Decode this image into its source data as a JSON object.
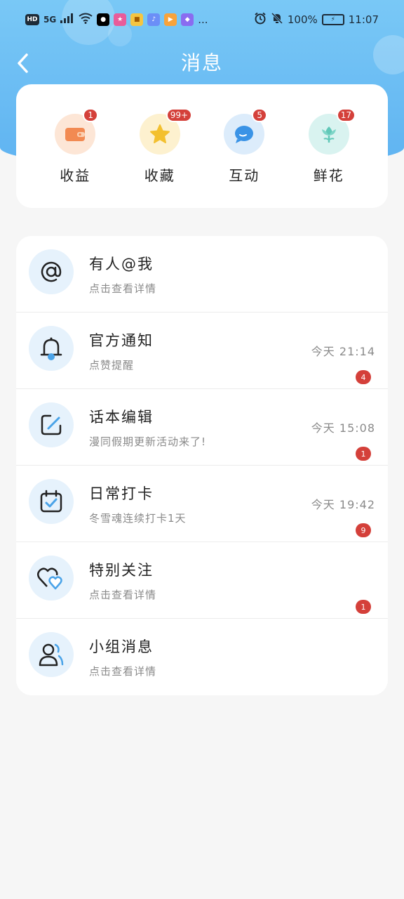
{
  "status_bar": {
    "left_indicators": [
      "HD",
      "5G",
      "..."
    ],
    "battery": "100%",
    "time": "11:07"
  },
  "header": {
    "title": "消息"
  },
  "quick_actions": [
    {
      "label": "收益",
      "badge": "1",
      "icon": "wallet-icon",
      "bg": "#fde6d6",
      "color": "#f28a52"
    },
    {
      "label": "收藏",
      "badge": "99+",
      "icon": "star-icon",
      "bg": "#fdf1cf",
      "color": "#f3c02f"
    },
    {
      "label": "互动",
      "badge": "5",
      "icon": "chat-bubble-icon",
      "bg": "#dcecfb",
      "color": "#3a93e6"
    },
    {
      "label": "鲜花",
      "badge": "17",
      "icon": "flower-icon",
      "bg": "#d9f3f0",
      "color": "#61c8b8"
    }
  ],
  "messages": [
    {
      "title": "有人@我",
      "subtitle": "点击查看详情",
      "time": "",
      "badge": "",
      "icon": "at-icon"
    },
    {
      "title": "官方通知",
      "subtitle": "点赞提醒",
      "time": "今天 21:14",
      "badge": "4",
      "icon": "bell-icon"
    },
    {
      "title": "话本编辑",
      "subtitle": "漫同假期更新活动来了!",
      "time": "今天 15:08",
      "badge": "1",
      "icon": "edit-icon"
    },
    {
      "title": "日常打卡",
      "subtitle": "冬雪魂连续打卡1天",
      "time": "今天 19:42",
      "badge": "9",
      "icon": "calendar-check-icon"
    },
    {
      "title": "特别关注",
      "subtitle": "点击查看详情",
      "time": "",
      "badge": "1",
      "icon": "hearts-icon"
    },
    {
      "title": "小组消息",
      "subtitle": "点击查看详情",
      "time": "",
      "badge": "",
      "icon": "group-icon"
    }
  ],
  "colors": {
    "accent": "#5fb3f1",
    "badge": "#d4403a",
    "icon_accent": "#4aa3e8"
  }
}
